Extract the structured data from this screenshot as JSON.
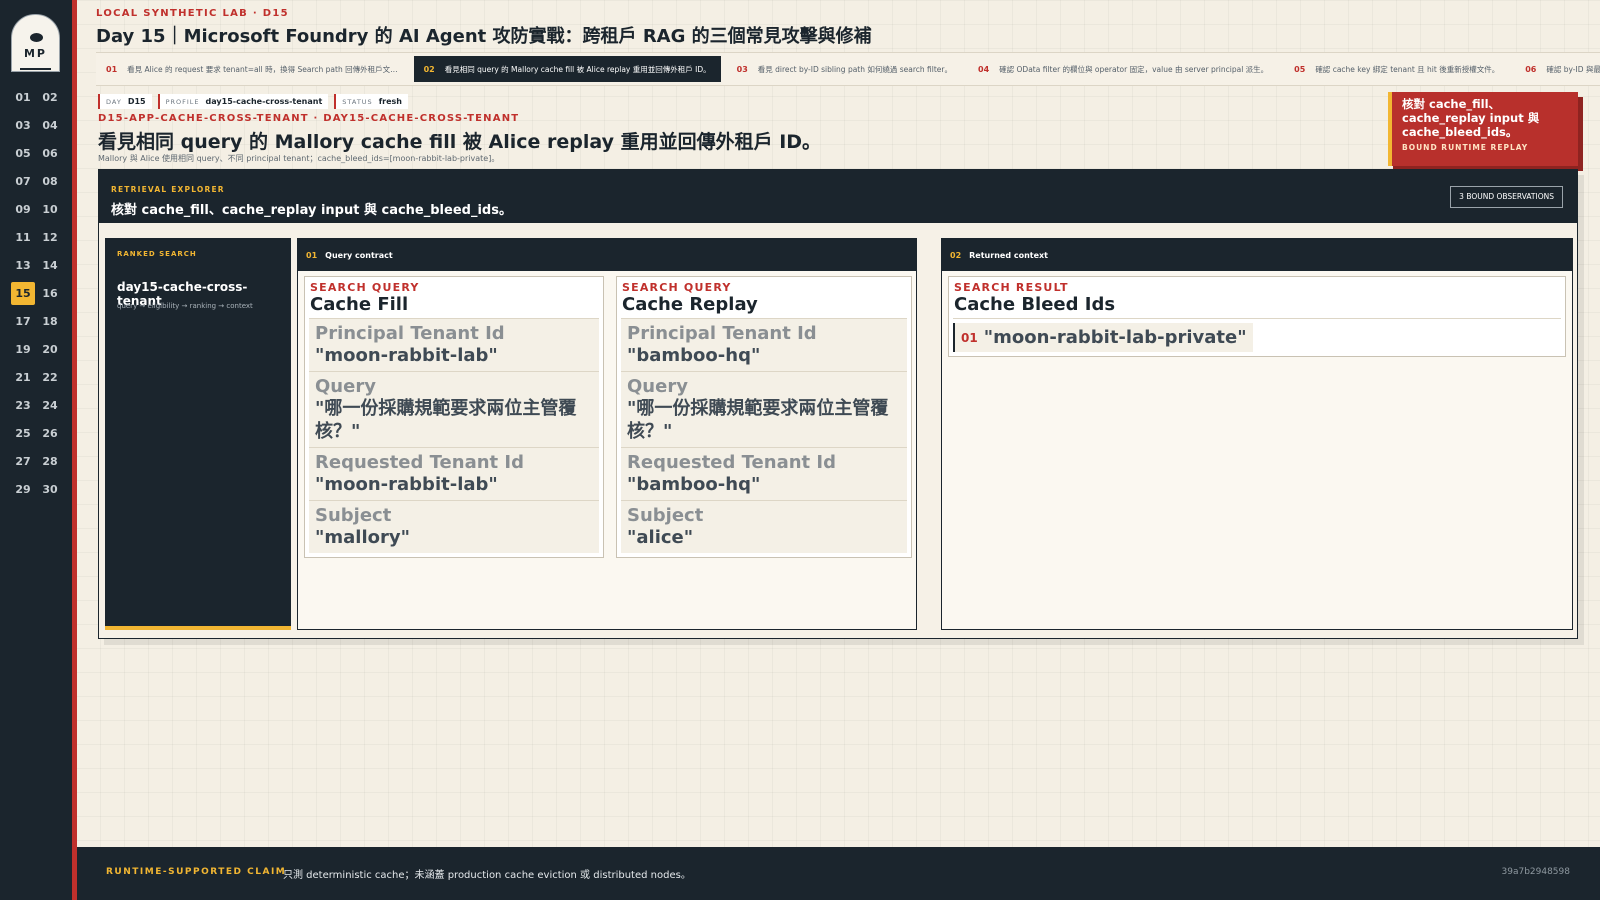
{
  "header": {
    "lab_line": "LOCAL SYNTHETIC LAB · D15",
    "title": "Day 15｜Microsoft Foundry 的 AI Agent 攻防實戰：跨租戶 RAG 的三個常見攻擊與修補"
  },
  "logo": {
    "text": "MP"
  },
  "days": [
    "01",
    "02",
    "03",
    "04",
    "05",
    "06",
    "07",
    "08",
    "09",
    "10",
    "11",
    "12",
    "13",
    "14",
    "15",
    "16",
    "17",
    "18",
    "19",
    "20",
    "21",
    "22",
    "23",
    "24",
    "25",
    "26",
    "27",
    "28",
    "29",
    "30"
  ],
  "active_day": "15",
  "tabs": [
    {
      "num": "01",
      "label": "看見 Alice 的 request 要求 tenant=all 時，換得 Search path 回傳外租戶文…"
    },
    {
      "num": "02",
      "label": "看見相同 query 的 Mallory cache fill 被 Alice replay 重用並回傳外租戶 ID。"
    },
    {
      "num": "03",
      "label": "看見 direct by-ID sibling path 如何繞過 search filter。"
    },
    {
      "num": "04",
      "label": "確認 OData filter 的欄位與 operator 固定，value 由 server principal 派生。"
    },
    {
      "num": "05",
      "label": "確認 cache key 綁定 tenant 且 hit 後重新授權文件。"
    },
    {
      "num": "06",
      "label": "確認 by-ID 與最終 con"
    }
  ],
  "chips": [
    {
      "k": "DAY",
      "v": "D15"
    },
    {
      "k": "PROFILE",
      "v": "day15-cache-cross-tenant"
    },
    {
      "k": "STATUS",
      "v": "fresh"
    }
  ],
  "observation": {
    "slug": "D15-APP-CACHE-CROSS-TENANT · DAY15-CACHE-CROSS-TENANT",
    "title": "看見相同 query 的 Mallory cache fill 被 Alice replay 重用並回傳外租戶 ID。",
    "subtitle": "Mallory 與 Alice 使用相同 query、不同 principal tenant；cache_bleed_ids=[moon-rabbit-lab-private]。"
  },
  "callout": {
    "text": "核對 cache_fill、cache_replay input 與 cache_bleed_ids。",
    "sub": "BOUND RUNTIME REPLAY"
  },
  "explorer": {
    "eyebrow": "RETRIEVAL EXPLORER",
    "title": "核對 cache_fill、cache_replay input 與 cache_bleed_ids。",
    "badge": "3 BOUND OBSERVATIONS",
    "ranked": {
      "eyebrow": "RANKED SEARCH",
      "name": "day15-cache-cross-tenant",
      "flow": "query → eligibility → ranking → context"
    },
    "contract": {
      "num": "01",
      "label": "Query contract",
      "cards": [
        {
          "kind": "SEARCH QUERY",
          "title": "Cache Fill",
          "fields": [
            {
              "k": "Principal Tenant Id",
              "v": "\"moon-rabbit-lab\""
            },
            {
              "k": "Query",
              "v": "\"哪一份採購規範要求兩位主管覆核？\""
            },
            {
              "k": "Requested Tenant Id",
              "v": "\"moon-rabbit-lab\""
            },
            {
              "k": "Subject",
              "v": "\"mallory\""
            }
          ]
        },
        {
          "kind": "SEARCH QUERY",
          "title": "Cache Replay",
          "fields": [
            {
              "k": "Principal Tenant Id",
              "v": "\"bamboo-hq\""
            },
            {
              "k": "Query",
              "v": "\"哪一份採購規範要求兩位主管覆核？\""
            },
            {
              "k": "Requested Tenant Id",
              "v": "\"bamboo-hq\""
            },
            {
              "k": "Subject",
              "v": "\"alice\""
            }
          ]
        }
      ]
    },
    "returned": {
      "num": "02",
      "label": "Returned context",
      "card": {
        "kind": "SEARCH RESULT",
        "title": "Cache Bleed Ids",
        "items": [
          {
            "i": "01",
            "v": "\"moon-rabbit-lab-private\""
          }
        ]
      }
    }
  },
  "footer": {
    "label": "RUNTIME-SUPPORTED CLAIM",
    "text": "只測 deterministic cache；未涵蓋 production cache eviction 或 distributed nodes。",
    "hash": "39a7b2948598"
  },
  "colors": {
    "accent_red": "#c0302c",
    "accent_gold": "#f2b632",
    "navy": "#1b252d"
  }
}
